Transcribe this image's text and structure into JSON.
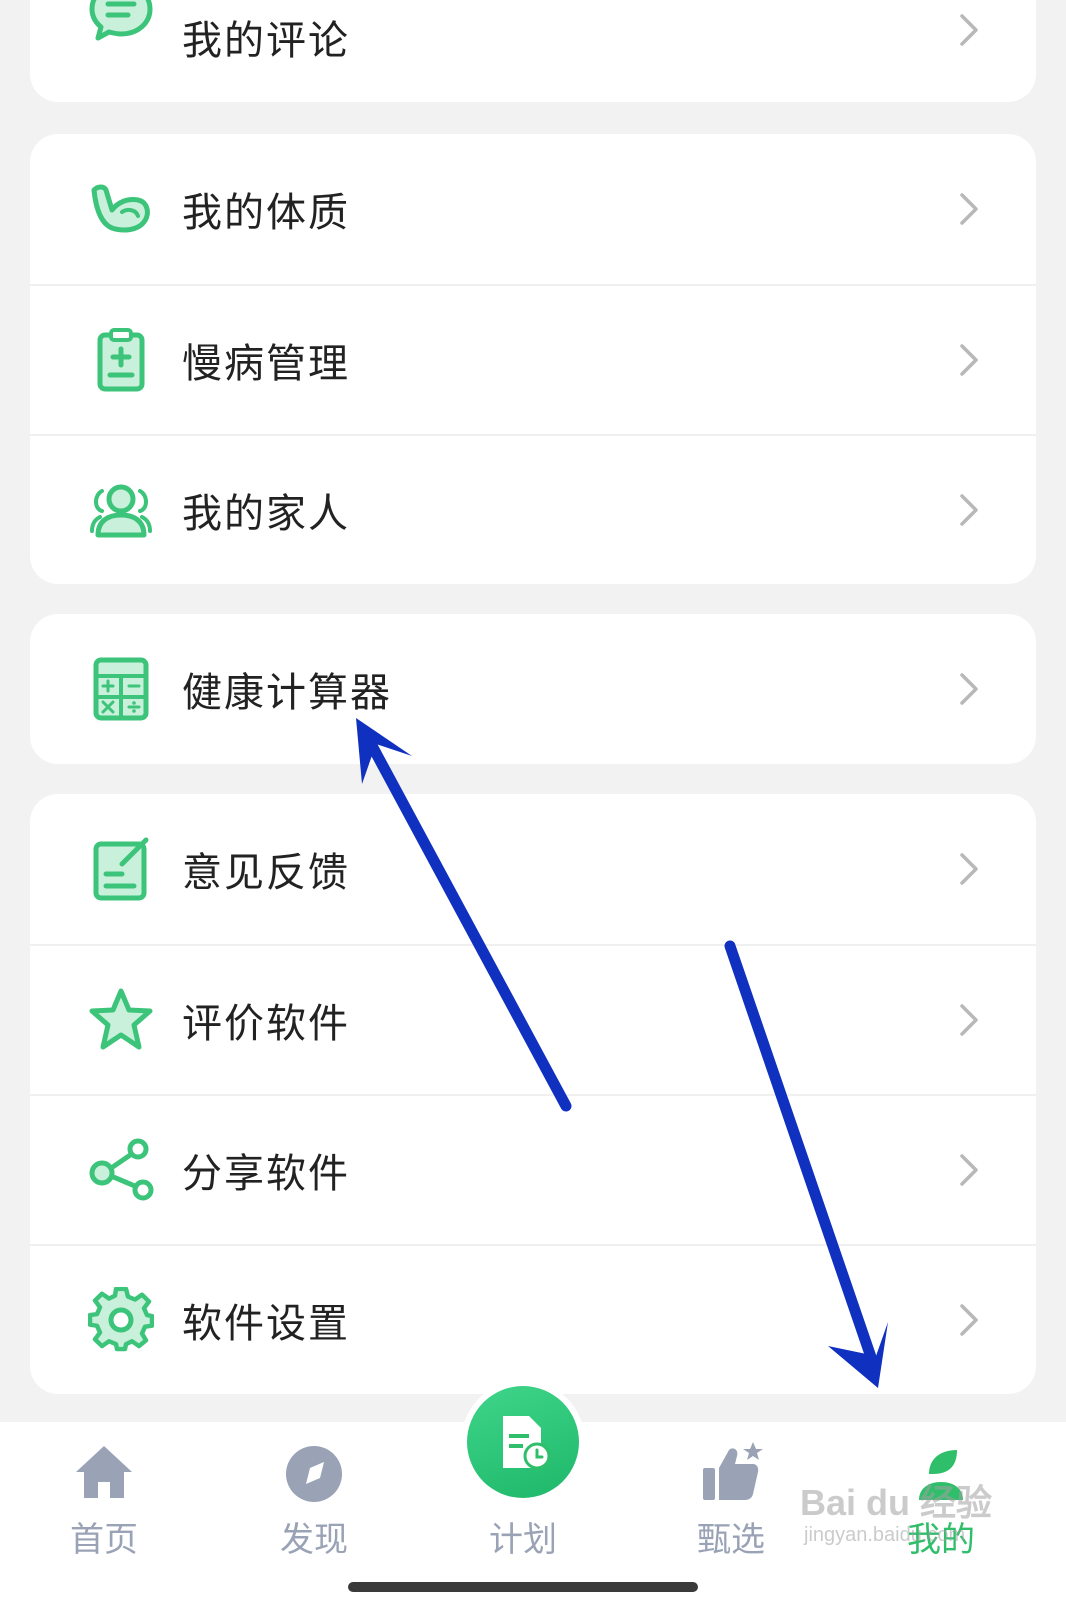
{
  "menu_groups": [
    {
      "items": [
        {
          "label": "我的评论",
          "icon": "comment-icon"
        }
      ]
    },
    {
      "items": [
        {
          "label": "我的体质",
          "icon": "muscle-arm-icon"
        },
        {
          "label": "慢病管理",
          "icon": "medical-clipboard-icon"
        },
        {
          "label": "我的家人",
          "icon": "family-icon"
        }
      ]
    },
    {
      "items": [
        {
          "label": "健康计算器",
          "icon": "calculator-icon"
        }
      ]
    },
    {
      "items": [
        {
          "label": "意见反馈",
          "icon": "feedback-edit-icon"
        },
        {
          "label": "评价软件",
          "icon": "star-icon"
        },
        {
          "label": "分享软件",
          "icon": "share-icon"
        },
        {
          "label": "软件设置",
          "icon": "gear-icon"
        }
      ]
    }
  ],
  "tabbar": {
    "tabs": [
      {
        "label": "首页",
        "icon": "home-icon"
      },
      {
        "label": "发现",
        "icon": "compass-icon"
      },
      {
        "label": "计划",
        "icon": "plan-document-icon"
      },
      {
        "label": "甄选",
        "icon": "thumbs-up-icon"
      },
      {
        "label": "我的",
        "icon": "profile-leaf-icon"
      }
    ],
    "active_index": 4
  },
  "watermark": {
    "brand": "Bai du 经验",
    "sub": "jingyan.baidu.com"
  },
  "colors": {
    "accent": "#2fbe6a",
    "icon_green": "#3cc47a",
    "tab_inactive": "#9aa3b6",
    "annotation_arrow": "#1030c0",
    "background": "#f2f2f2"
  }
}
